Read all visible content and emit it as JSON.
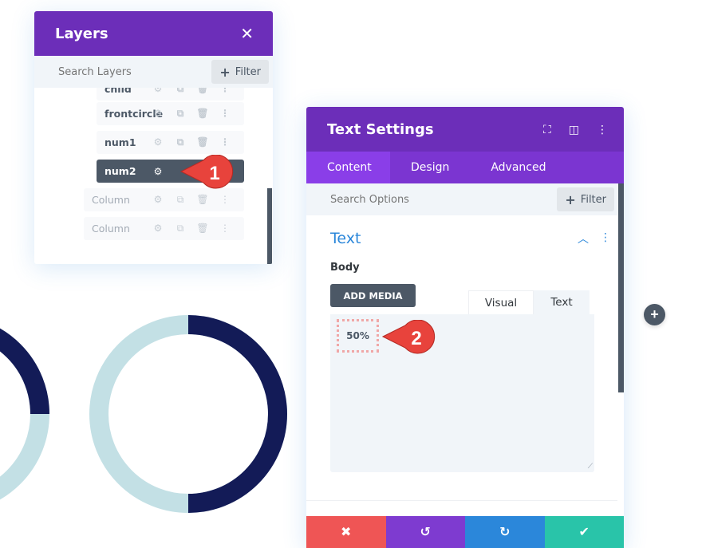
{
  "colors": {
    "purple_header": "#6c2eb9",
    "purple_tabs": "#7b35d1",
    "purple_tab_active": "#8a3ee8",
    "accent_blue": "#2b87da",
    "dark_slate": "#4c5866",
    "ring_dark": "#131b57",
    "ring_light": "#c3e0e5",
    "badge_red": "#e8433c",
    "footer_cancel": "#ef5555",
    "footer_undo": "#7e3bd0",
    "footer_redo": "#2b87da",
    "footer_save": "#29c4a9"
  },
  "layers_panel": {
    "title": "Layers",
    "close_icon": "close-icon",
    "search_placeholder": "Search Layers",
    "filter_label": "Filter",
    "items": [
      {
        "label": "child",
        "type": "module",
        "state": "partially-hidden"
      },
      {
        "label": "frontcircle",
        "type": "module"
      },
      {
        "label": "num1",
        "type": "module"
      },
      {
        "label": "num2",
        "type": "module",
        "state": "active"
      },
      {
        "label": "Column",
        "type": "column"
      },
      {
        "label": "Column",
        "type": "column"
      }
    ],
    "row_icons": [
      "gear-icon",
      "duplicate-icon",
      "trash-icon",
      "more-icon"
    ]
  },
  "badges": [
    {
      "number": "1"
    },
    {
      "number": "2"
    }
  ],
  "text_settings": {
    "title": "Text Settings",
    "header_icons": [
      "fullscreen-icon",
      "split-view-icon",
      "more-icon"
    ],
    "tabs": [
      {
        "label": "Content",
        "active": true
      },
      {
        "label": "Design",
        "active": false
      },
      {
        "label": "Advanced",
        "active": false
      }
    ],
    "search_placeholder": "Search Options",
    "filter_label": "Filter",
    "section_title": "Text",
    "body_label": "Body",
    "add_media_label": "ADD MEDIA",
    "editor_modes": [
      {
        "label": "Visual",
        "active": false
      },
      {
        "label": "Text",
        "active": true
      }
    ],
    "editor_value": "50%",
    "footer": {
      "cancel_icon": "close-icon",
      "undo_icon": "undo-icon",
      "redo_icon": "redo-icon",
      "save_icon": "check-icon"
    }
  },
  "canvas": {
    "rings": [
      {
        "name": "left-ring",
        "percent": 25,
        "state": "partially-visible"
      },
      {
        "name": "right-ring",
        "percent": 50
      }
    ],
    "add_button": "add-icon"
  }
}
